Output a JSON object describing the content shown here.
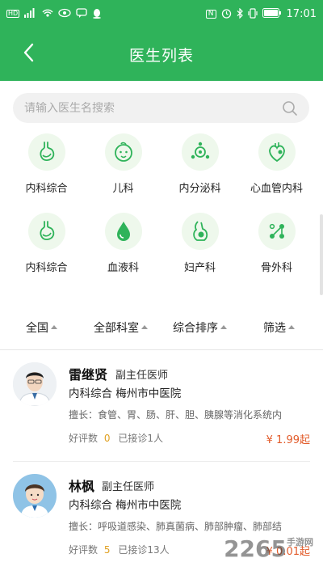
{
  "statusbar": {
    "left_icons": [
      "HD",
      "4G",
      "wifi",
      "eye",
      "chat",
      "qq"
    ],
    "nfc": "N",
    "battery_label": "",
    "time": "17:01"
  },
  "navbar": {
    "title": "医生列表"
  },
  "search": {
    "placeholder": "请输入医生名搜索"
  },
  "categories": [
    {
      "label": "内科综合",
      "icon": "stomach-icon"
    },
    {
      "label": "儿科",
      "icon": "baby-icon"
    },
    {
      "label": "内分泌科",
      "icon": "endocrine-icon"
    },
    {
      "label": "心血管内科",
      "icon": "heart-icon"
    },
    {
      "label": "内科综合",
      "icon": "stomach-icon"
    },
    {
      "label": "血液科",
      "icon": "blood-drop-icon"
    },
    {
      "label": "妇产科",
      "icon": "pregnancy-icon"
    },
    {
      "label": "骨外科",
      "icon": "bone-icon"
    }
  ],
  "filters": [
    "全国",
    "全部科室",
    "综合排序",
    "筛选"
  ],
  "doctors": [
    {
      "name": "雷继贤",
      "title": "副主任医师",
      "hospital": "内科综合  梅州市中医院",
      "specialty": "擅长：食管、胃、肠、肝、胆、胰腺等消化系统内",
      "rating_label": "好评数",
      "rating": "0",
      "consult": "已接诊1人",
      "price": "¥ 1.99起"
    },
    {
      "name": "林枫",
      "title": "副主任医师",
      "hospital": "内科综合  梅州市中医院",
      "specialty": "擅长：呼吸道感染、肺真菌病、肺部肿瘤、肺部结",
      "rating_label": "好评数",
      "rating": "5",
      "consult": "已接诊13人",
      "price": "¥ 0.01起"
    }
  ],
  "watermark": {
    "text": "2265",
    "sub": "手游网"
  },
  "colors": {
    "brand": "#2fb35a",
    "price": "#e25b2a",
    "rating": "#e0a020"
  }
}
